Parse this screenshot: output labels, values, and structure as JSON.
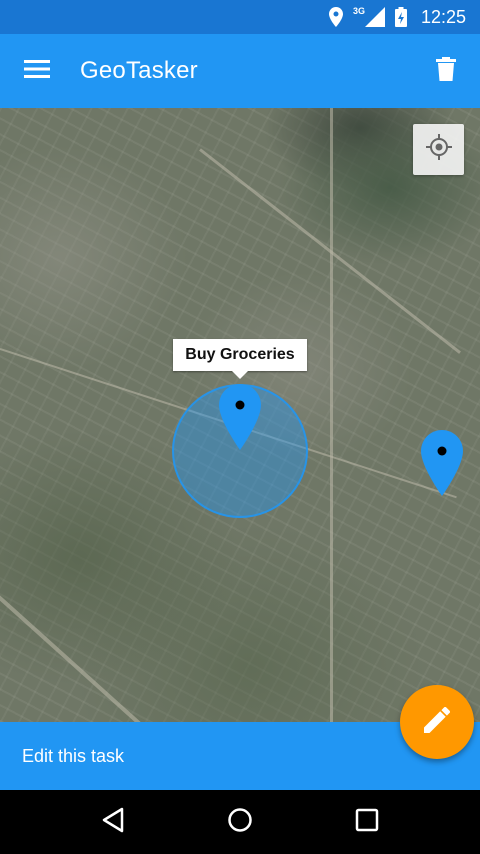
{
  "status_bar": {
    "network_type": "3G",
    "time": "12:25",
    "icons": [
      "location-icon",
      "signal-icon",
      "battery-charging-icon"
    ]
  },
  "app_bar": {
    "title": "GeoTasker",
    "menu_icon": "hamburger-menu-icon",
    "action_icon": "trash-icon"
  },
  "map": {
    "my_location_icon": "crosshair-icon",
    "selected_task": {
      "label": "Buy Groceries"
    },
    "markers": [
      "map-pin-icon",
      "map-pin-icon"
    ]
  },
  "bottom_bar": {
    "label": "Edit this task"
  },
  "fab": {
    "icon": "pencil-icon"
  },
  "nav_bar": {
    "icons": [
      "back-icon",
      "home-icon",
      "recents-icon"
    ]
  },
  "colors": {
    "primary": "#2196f3",
    "primary_dark": "#1976d2",
    "accent": "#ff9800",
    "geofence_fill": "rgba(33,150,243,0.42)"
  }
}
